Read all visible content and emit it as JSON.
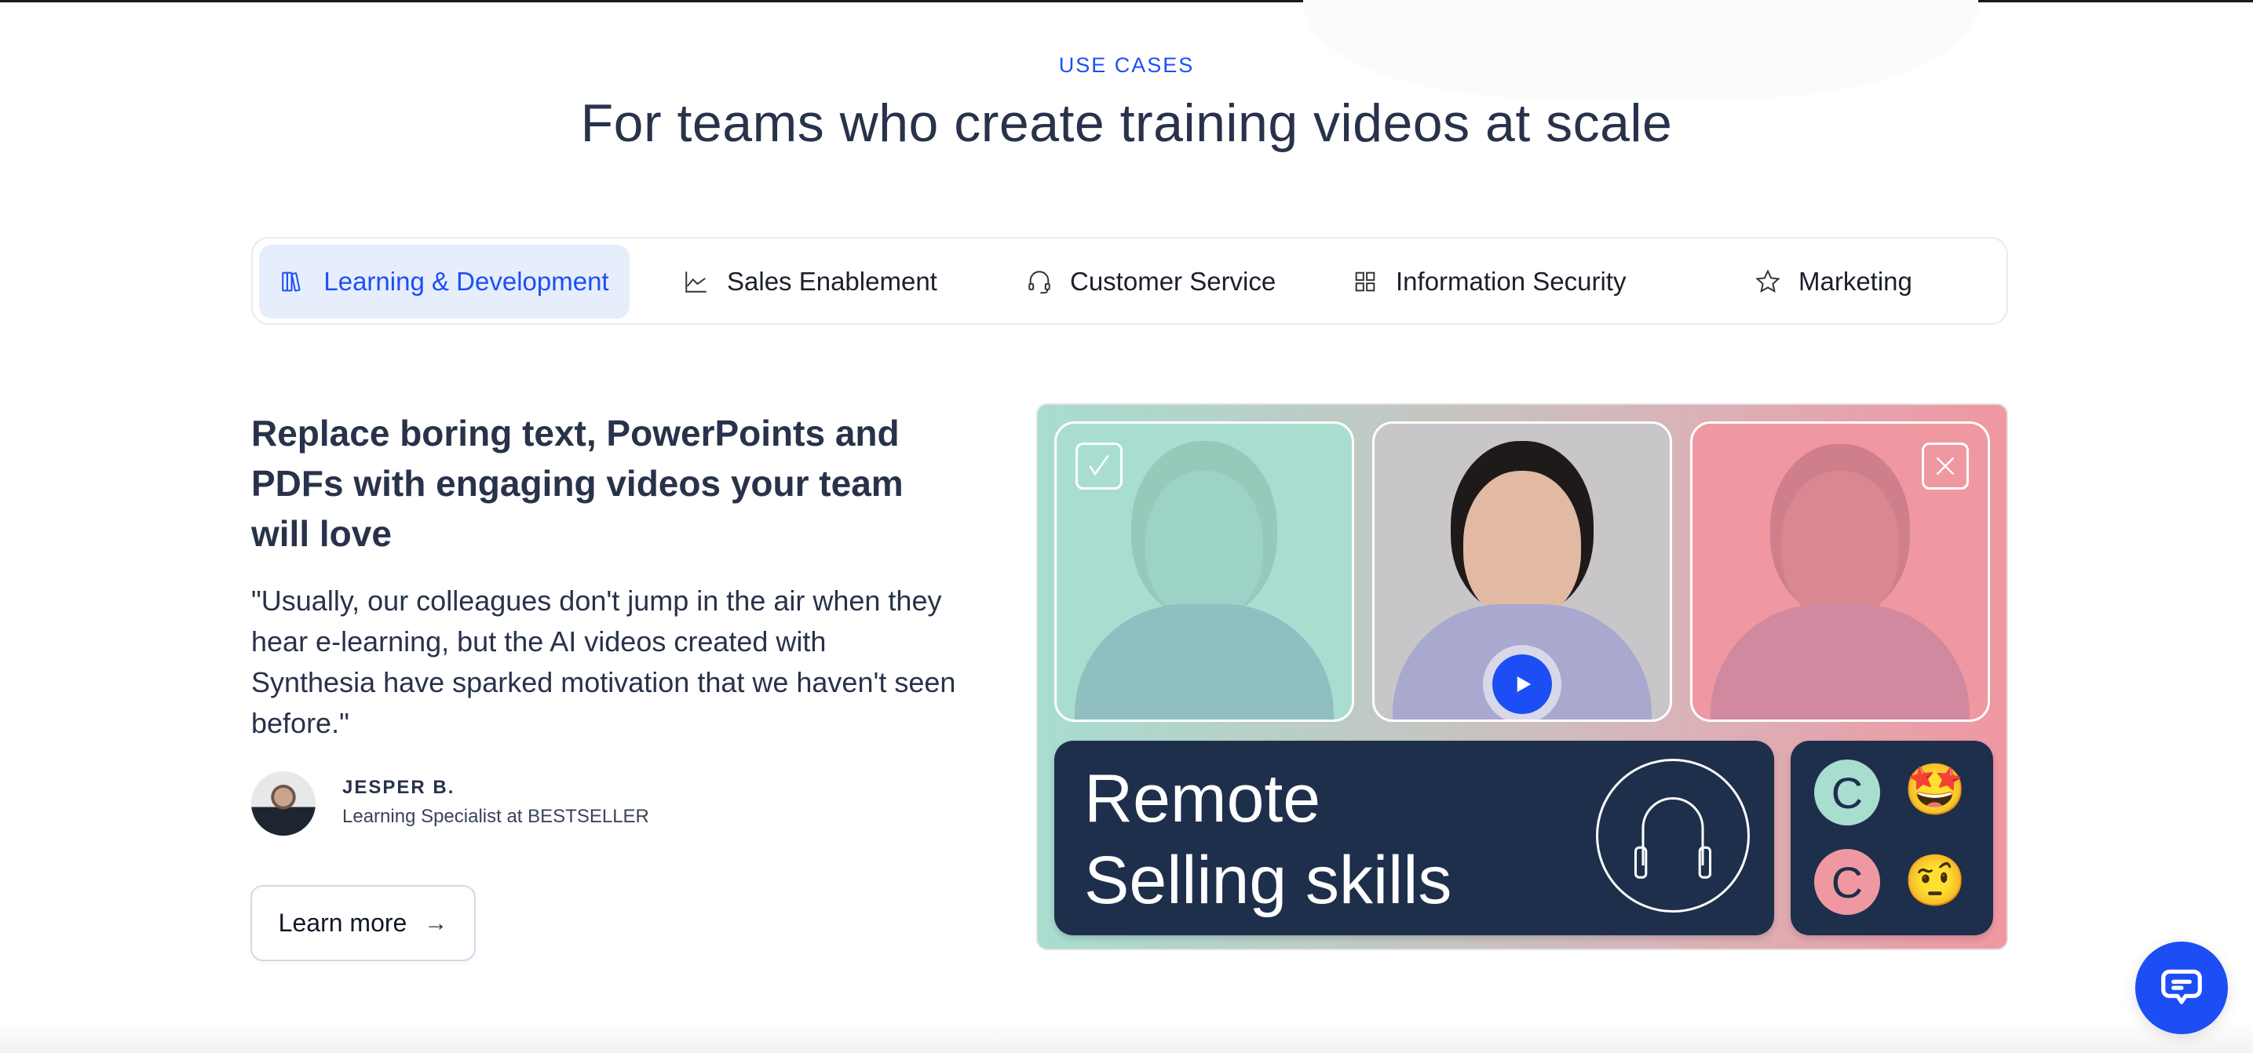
{
  "section": {
    "eyebrow": "USE CASES",
    "title": "For teams who create training videos at scale"
  },
  "tabs": [
    {
      "label": "Learning & Development",
      "icon": "books-icon",
      "active": true
    },
    {
      "label": "Sales Enablement",
      "icon": "line-chart-icon",
      "active": false
    },
    {
      "label": "Customer Service",
      "icon": "headset-icon",
      "active": false
    },
    {
      "label": "Information Security",
      "icon": "grid-icon",
      "active": false
    },
    {
      "label": "Marketing",
      "icon": "star-icon",
      "active": false
    }
  ],
  "content": {
    "heading": "Replace boring text, PowerPoints and PDFs with engaging videos your team will love",
    "quote": "\"Usually, our colleagues don't jump in the air when they hear e-learning, but the AI videos created with Synthesia have sparked motivation that we haven't seen before.\"",
    "person": {
      "name": "JESPER B.",
      "role": "Learning Specialist at BESTSELLER"
    },
    "cta": {
      "label": "Learn more",
      "arrow": "→"
    }
  },
  "preview": {
    "course_title_line1": "Remote",
    "course_title_line2": "Selling skills",
    "reaction_letter": "C",
    "reactions": [
      "🤩",
      "🤨"
    ],
    "colors": {
      "teal": "#a8ddd0",
      "pink": "#ef98a2",
      "navy": "#1e2f4c",
      "accent": "#1d4ef5"
    }
  },
  "colors": {
    "accent": "#1d4ef5",
    "text": "#28324a",
    "active_tab_bg": "#e6eefc"
  }
}
